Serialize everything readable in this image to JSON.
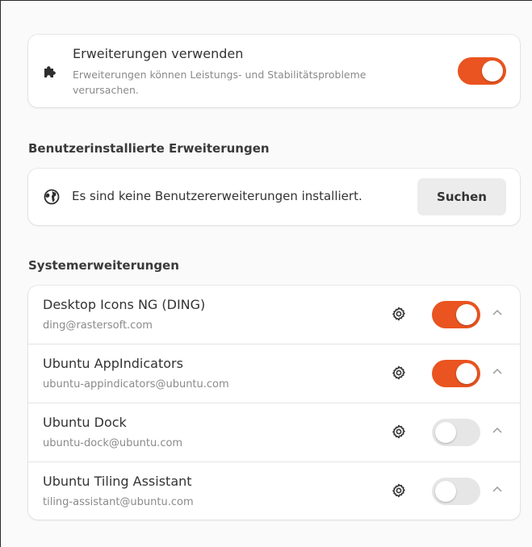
{
  "main": {
    "title": "Erweiterungen verwenden",
    "description": "Erweiterungen können Leistungs- und Stabilitätsprobleme verursachen.",
    "icon": "puzzle-icon",
    "enabled": true
  },
  "user_section": {
    "heading": "Benutzerinstallierte Erweiterungen",
    "empty_message": "Es sind keine Benutzererweiterungen installiert.",
    "icon": "globe-icon",
    "search_label": "Suchen"
  },
  "system_section": {
    "heading": "Systemerweiterungen",
    "items": [
      {
        "name": "Desktop Icons NG (DING)",
        "uuid": "ding@rastersoft.com",
        "enabled": true
      },
      {
        "name": "Ubuntu AppIndicators",
        "uuid": "ubuntu-appindicators@ubuntu.com",
        "enabled": true
      },
      {
        "name": "Ubuntu Dock",
        "uuid": "ubuntu-dock@ubuntu.com",
        "enabled": false
      },
      {
        "name": "Ubuntu Tiling Assistant",
        "uuid": "tiling-assistant@ubuntu.com",
        "enabled": false
      }
    ]
  },
  "colors": {
    "accent": "#e95420",
    "toggle_off": "#e6e6e6"
  }
}
